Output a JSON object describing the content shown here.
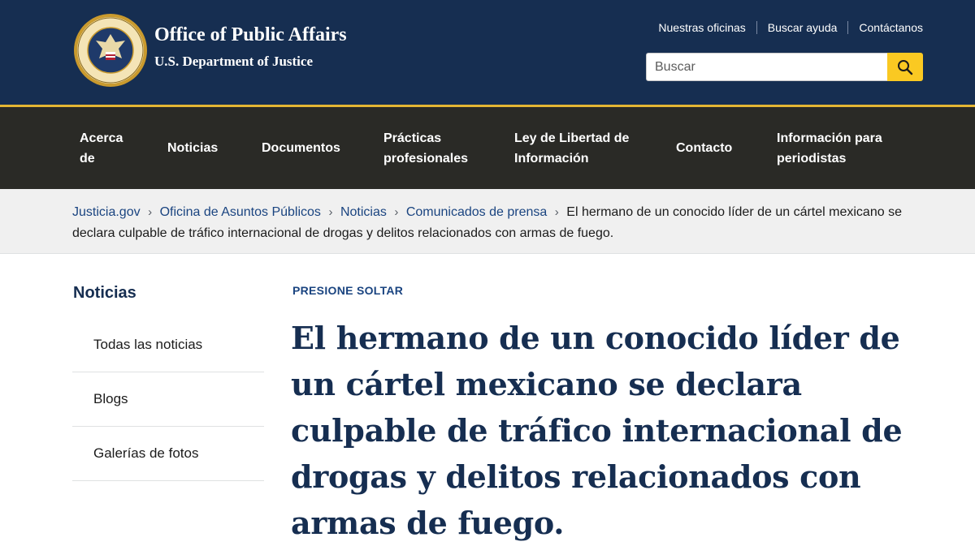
{
  "header": {
    "title": "Office of Public Affairs",
    "subtitle": "U.S. Department of Justice",
    "seal_lettering": "DEPARTMENT OF JUSTICE",
    "utility_links": [
      "Nuestras oficinas",
      "Buscar ayuda",
      "Contáctanos"
    ],
    "search_placeholder": "Buscar",
    "colors": {
      "background": "#162e51",
      "accent": "#e4b634",
      "search_button": "#fac922"
    }
  },
  "nav": {
    "items": [
      "Acerca de",
      "Noticias",
      "Documentos",
      "Prácticas profesionales",
      "Ley de Libertad de Información",
      "Contacto",
      "Información para periodistas"
    ],
    "background": "#2a2a26"
  },
  "breadcrumb": {
    "links": [
      "Justicia.gov",
      "Oficina de Asuntos Públicos",
      "Noticias",
      "Comunicados de prensa"
    ],
    "current": "El hermano de un conocido líder de un cártel mexicano se declara culpable de tráfico internacional de drogas y delitos relacionados con armas de fuego."
  },
  "sidebar": {
    "title": "Noticias",
    "items": [
      "Todas las noticias",
      "Blogs",
      "Galerías de fotos"
    ]
  },
  "article": {
    "eyebrow": "PRESIONE SOLTAR",
    "headline": "El hermano de un conocido líder de un cártel mexicano se declara culpable de tráfico internacional de drogas y delitos relacionados con armas de fuego."
  }
}
